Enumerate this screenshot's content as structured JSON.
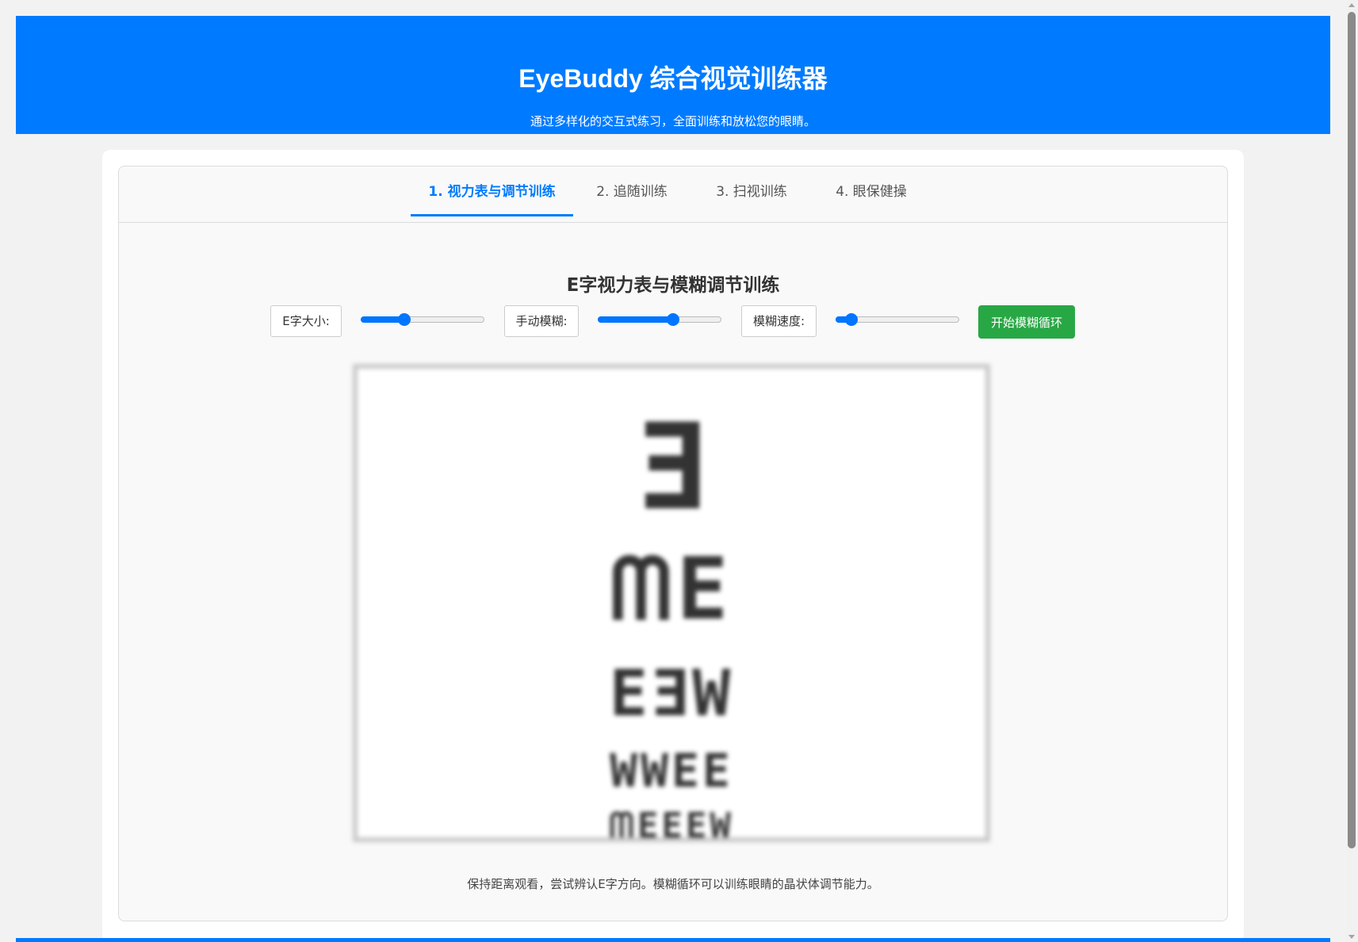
{
  "header": {
    "title": "EyeBuddy 综合视觉训练器",
    "subtitle": "通过多样化的交互式练习，全面训练和放松您的眼睛。",
    "color": "#007bff"
  },
  "tabs": [
    {
      "label": "1. 视力表与调节训练",
      "active": true
    },
    {
      "label": "2. 追随训练",
      "active": false
    },
    {
      "label": "3. 扫视训练",
      "active": false
    },
    {
      "label": "4. 眼保健操",
      "active": false
    }
  ],
  "section": {
    "title": "E字视力表与模糊调节训练",
    "controls": {
      "size_label": "E字大小:",
      "size_value_fraction": 0.36,
      "blur_label": "手动模糊:",
      "blur_value_fraction": 0.62,
      "speed_label": "模糊速度:",
      "speed_value_fraction": 0.13,
      "start_button": "开始模糊循环",
      "start_button_color": "#28a745"
    },
    "chart_rows": [
      "Ǝ",
      "ᗰE",
      "EƎW",
      "WWEE",
      "ᗰEEEW"
    ],
    "hint": "保持距离观看，尝试辨认E字方向。模糊循环可以训练眼睛的晶状体调节能力。"
  }
}
